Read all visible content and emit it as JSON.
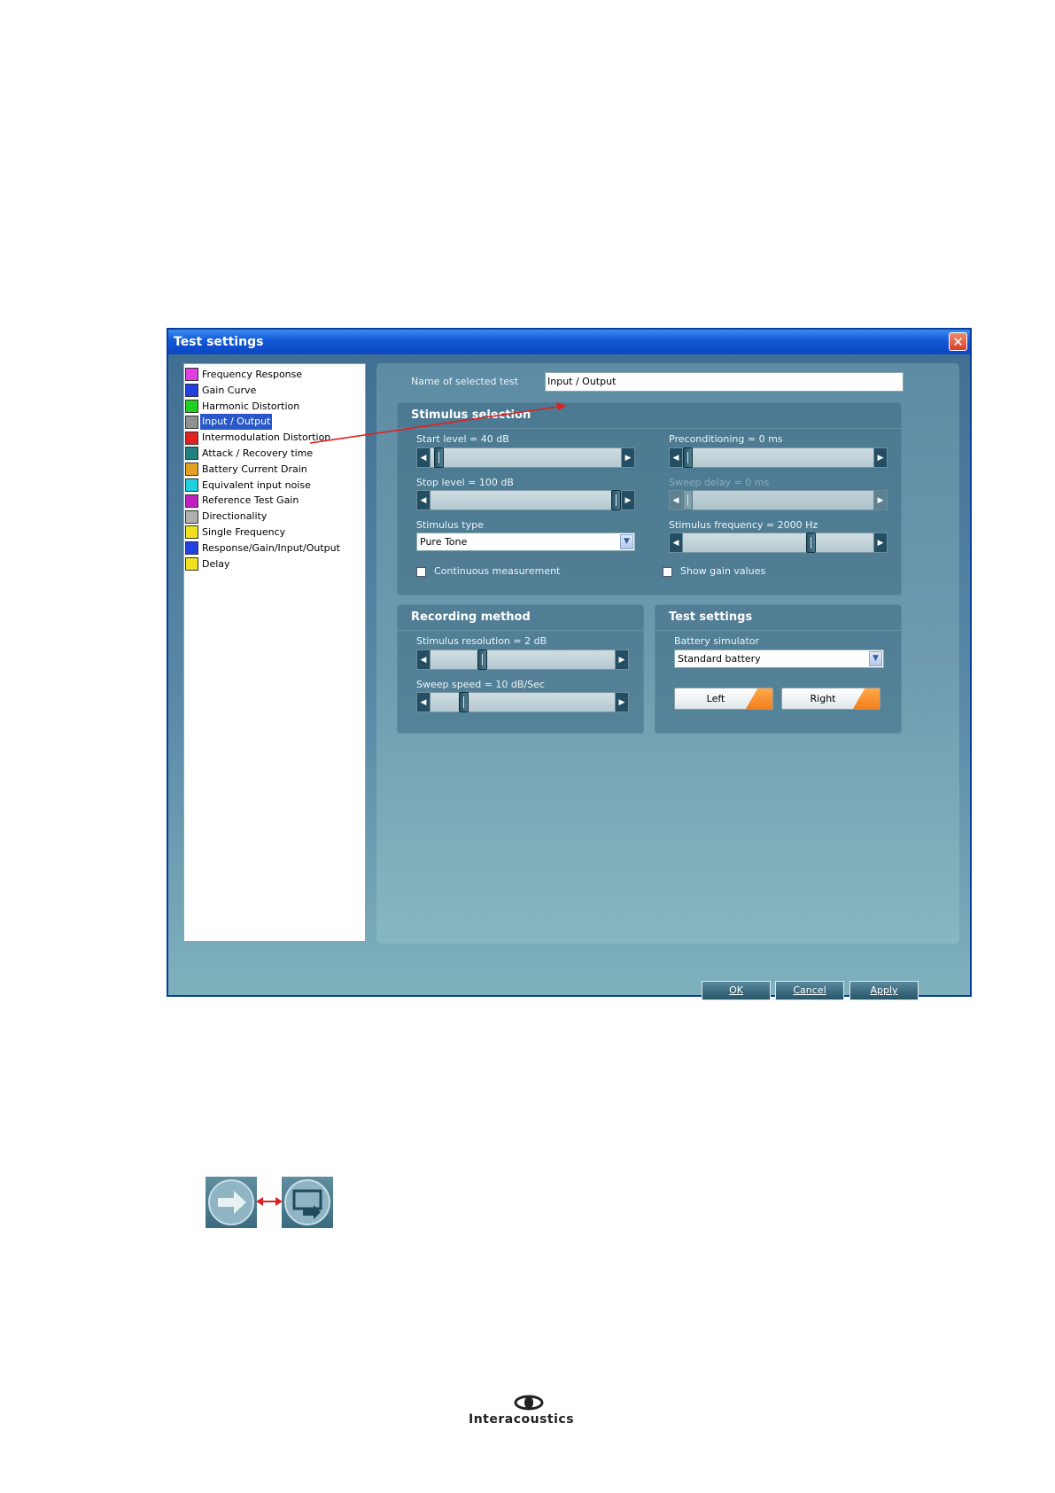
{
  "window": {
    "title": "Test settings",
    "close_symbol": "✕"
  },
  "tests": [
    {
      "label": "Frequency Response",
      "icon": "frequency-response-icon",
      "color": "#e040e0"
    },
    {
      "label": "Gain Curve",
      "icon": "gain-curve-icon",
      "color": "#2040e0"
    },
    {
      "label": "Harmonic Distortion",
      "icon": "harmonic-distortion-icon",
      "color": "#20d020"
    },
    {
      "label": "Input / Output",
      "icon": "input-output-icon",
      "color": "#909090",
      "selected": true
    },
    {
      "label": "Intermodulation Distortion",
      "icon": "intermodulation-distortion-icon",
      "color": "#e02020"
    },
    {
      "label": "Attack / Recovery time",
      "icon": "attack-recovery-icon",
      "color": "#208080"
    },
    {
      "label": "Battery Current Drain",
      "icon": "battery-current-drain-icon",
      "color": "#e0a020"
    },
    {
      "label": "Equivalent input noise",
      "icon": "equivalent-input-noise-icon",
      "color": "#20d0e0"
    },
    {
      "label": "Reference Test Gain",
      "icon": "reference-test-gain-icon",
      "color": "#c020c0"
    },
    {
      "label": "Directionality",
      "icon": "directionality-icon",
      "color": "#b0b0b0"
    },
    {
      "label": "Single Frequency",
      "icon": "single-frequency-icon",
      "color": "#f0e020"
    },
    {
      "label": "Response/Gain/Input/Output",
      "icon": "response-gain-input-output-icon",
      "color": "#2040e0"
    },
    {
      "label": "Delay",
      "icon": "delay-icon",
      "color": "#f0e020"
    }
  ],
  "name_field": {
    "label": "Name of selected test",
    "value": "Input / Output"
  },
  "stimulus": {
    "title": "Stimulus selection",
    "start_level": {
      "label": "Start level = 40 dB",
      "fraction": 0.02
    },
    "stop_level": {
      "label": "Stop level = 100 dB",
      "fraction": 1.0
    },
    "stimulus_type_label": "Stimulus type",
    "stimulus_type_value": "Pure Tone",
    "continuous_label": "Continuous measurement",
    "preconditioning": {
      "label": "Preconditioning = 0 ms",
      "fraction": 0.0
    },
    "sweep_delay": {
      "label": "Sweep delay = 0 ms",
      "fraction": 0.0
    },
    "stimulus_frequency": {
      "label": "Stimulus frequency = 2000 Hz",
      "fraction": 0.68
    },
    "show_gain_label": "Show gain values"
  },
  "recording": {
    "title": "Recording method",
    "resolution": {
      "label": "Stimulus resolution = 2 dB",
      "fraction": 0.27
    },
    "sweep_speed": {
      "label": "Sweep speed = 10 dB/Sec",
      "fraction": 0.16
    }
  },
  "test_settings": {
    "title": "Test settings",
    "battery_label": "Battery simulator",
    "battery_value": "Standard battery",
    "left_label": "Left",
    "right_label": "Right"
  },
  "buttons": {
    "ok": "OK",
    "cancel": "Cancel",
    "apply": "Apply"
  },
  "footer": {
    "logo_text": "Interacoustics"
  },
  "colors": {
    "accent_orange": "#f07c16",
    "annotation_red": "#e02020",
    "title_blue": "#1257d6"
  }
}
